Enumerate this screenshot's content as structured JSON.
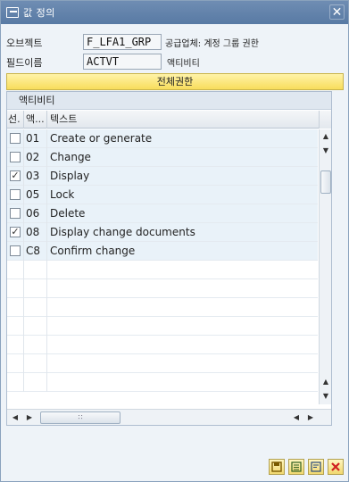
{
  "window": {
    "title": "값 정의",
    "close_glyph": "✕"
  },
  "fields": {
    "object_label": "오브젝트",
    "object_value": "F_LFA1_GRP",
    "object_desc": "공급업체: 계정 그룹 권한",
    "fieldname_label": "필드이름",
    "fieldname_value": "ACTVT",
    "fieldname_desc": "액티비티"
  },
  "all_auth_button": "전체권한",
  "table": {
    "title": "액티비티",
    "columns": {
      "select": "선.",
      "activity": "액...",
      "text": "텍스트"
    },
    "rows": [
      {
        "checked": false,
        "code": "01",
        "text": "Create or generate"
      },
      {
        "checked": false,
        "code": "02",
        "text": "Change"
      },
      {
        "checked": true,
        "code": "03",
        "text": "Display"
      },
      {
        "checked": false,
        "code": "05",
        "text": "Lock"
      },
      {
        "checked": false,
        "code": "06",
        "text": "Delete"
      },
      {
        "checked": true,
        "code": "08",
        "text": "Display change documents"
      },
      {
        "checked": false,
        "code": "C8",
        "text": "Confirm change"
      }
    ],
    "empty_rows": 7,
    "check_glyph": "✓"
  },
  "toolbar": {
    "buttons": [
      {
        "name": "save-icon",
        "color": "#c78a00"
      },
      {
        "name": "select-all-icon",
        "color": "#3a7a2a"
      },
      {
        "name": "deselect-icon",
        "color": "#3a5a8a"
      },
      {
        "name": "cancel-icon",
        "color": "#d02020"
      }
    ]
  }
}
